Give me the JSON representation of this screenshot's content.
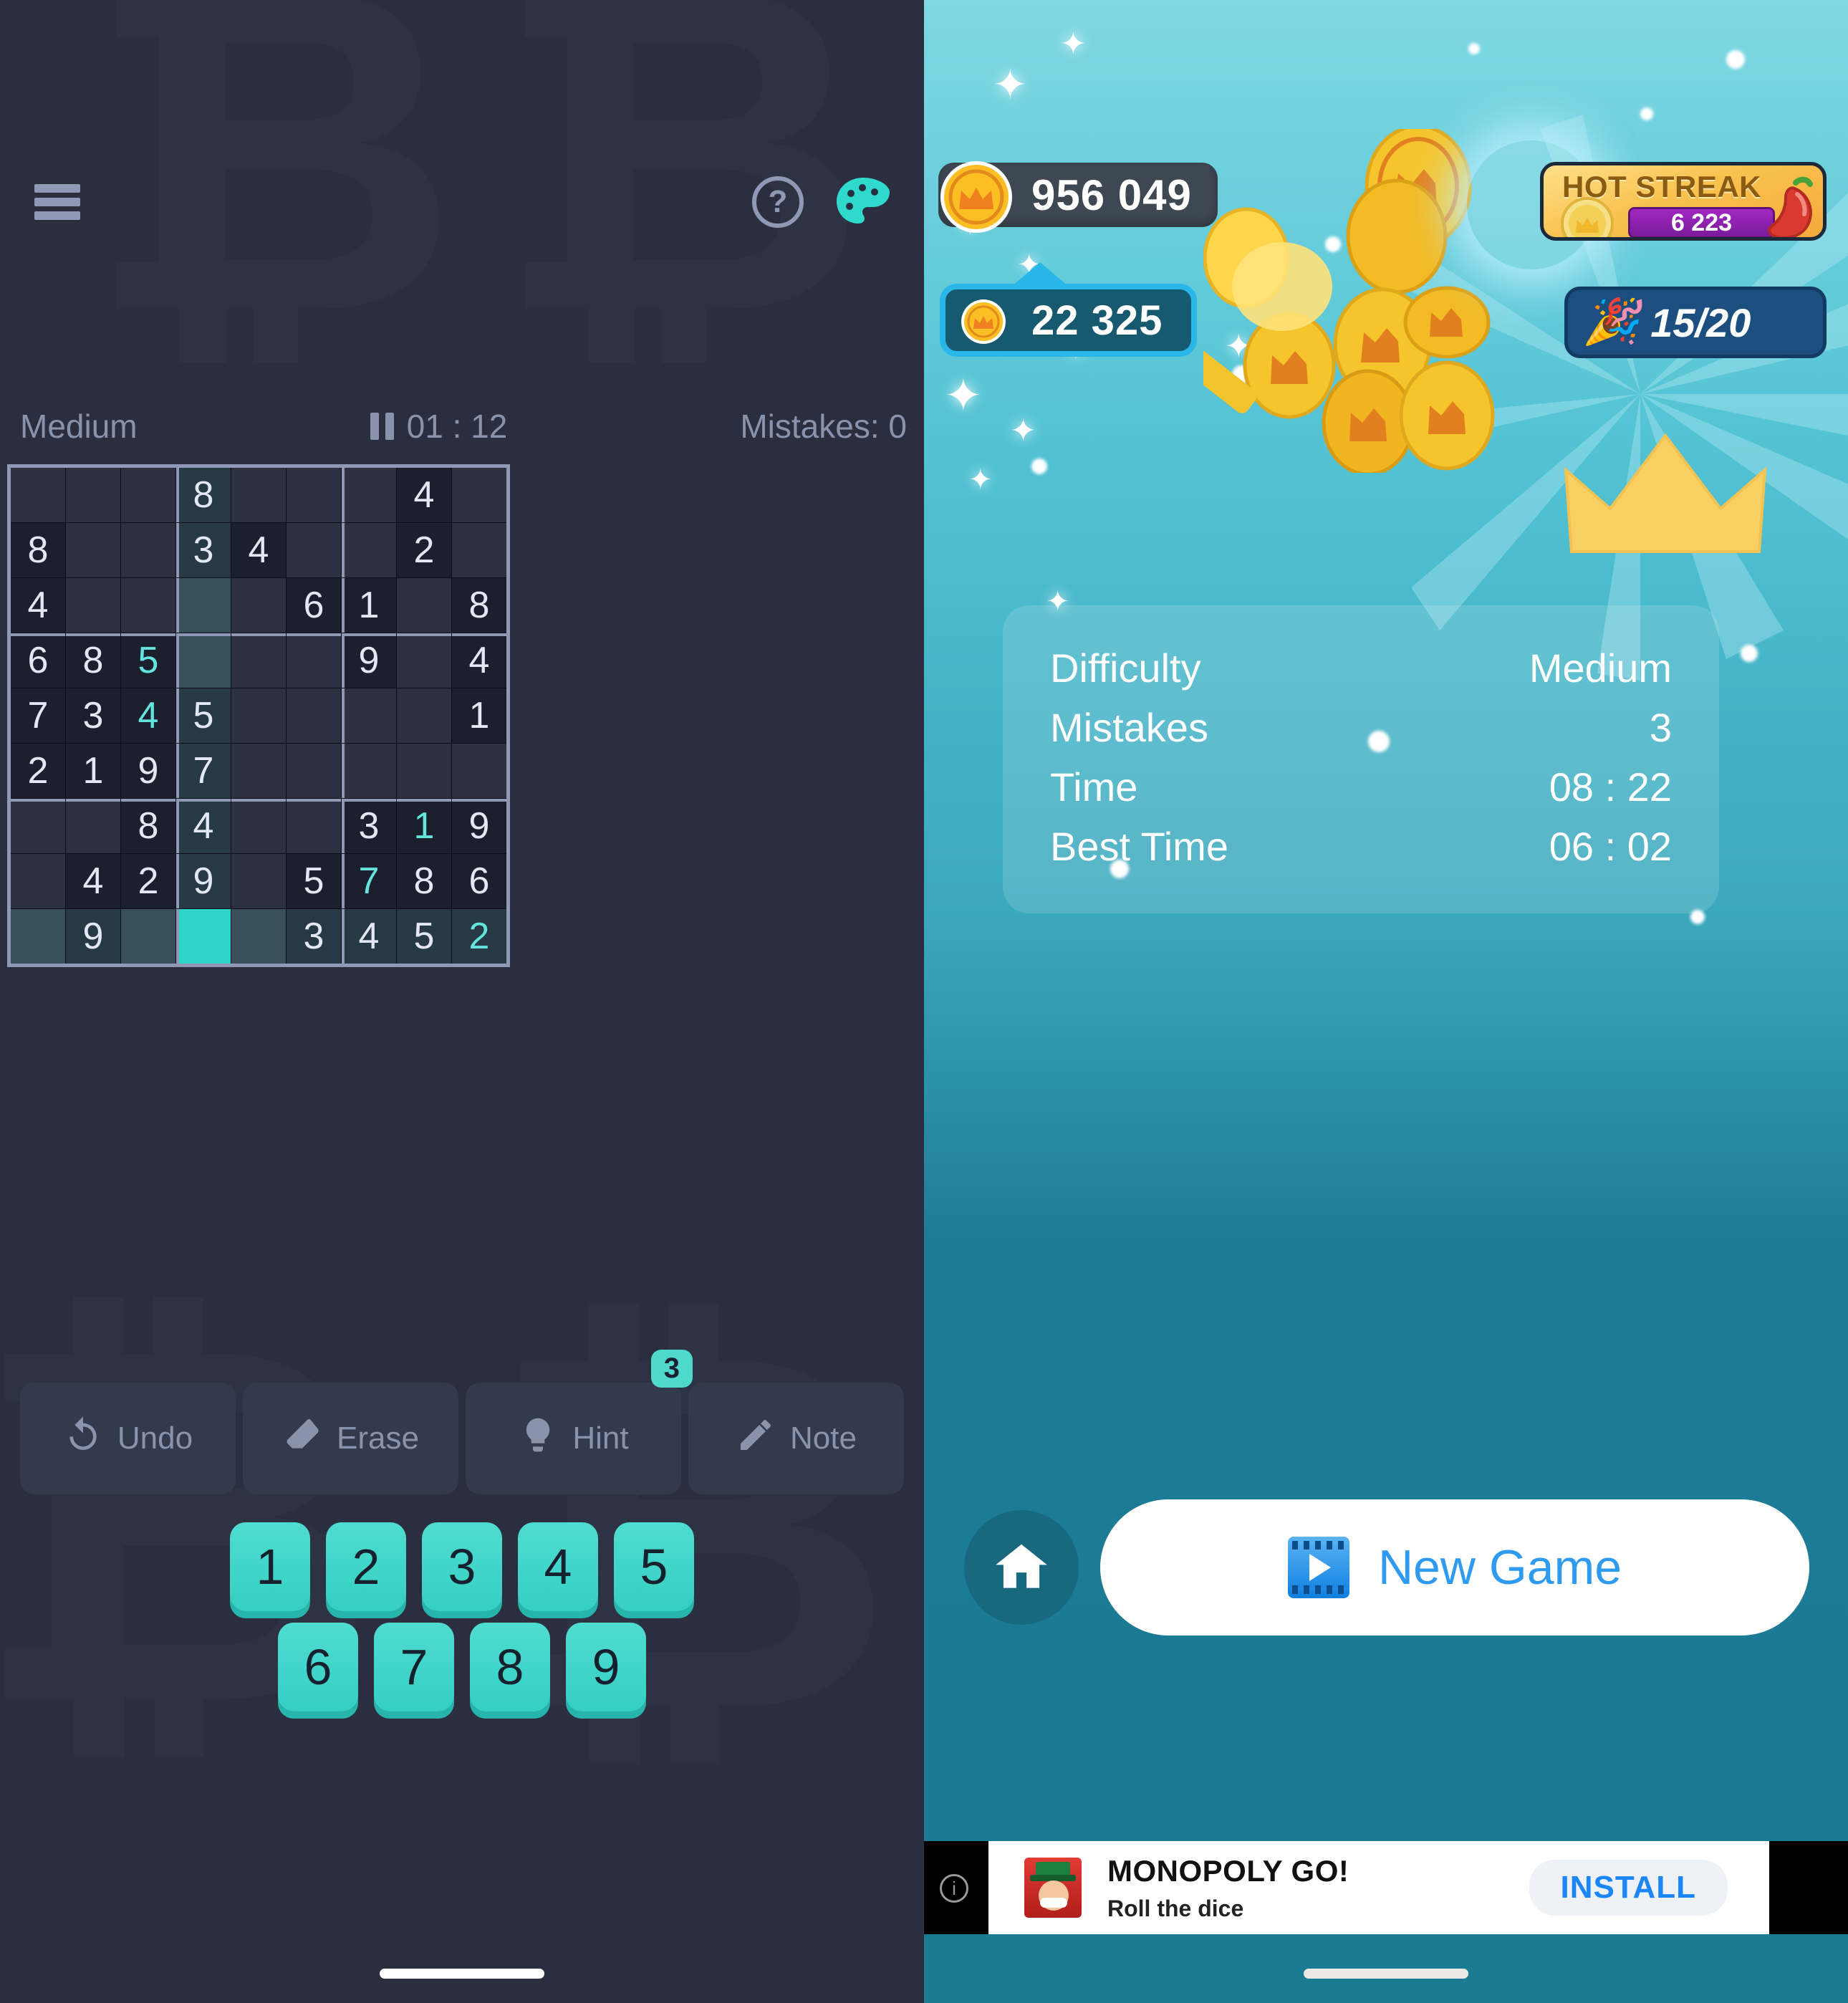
{
  "left_pane": {
    "header": {
      "menu_icon": "hamburger-menu-icon",
      "help_icon": "question-mark-icon",
      "help_glyph": "?",
      "theme_icon": "palette-icon"
    },
    "status": {
      "difficulty": "Medium",
      "pause_icon": "pause-icon",
      "timer": "01 : 12",
      "mistakes": "Mistakes: 0"
    },
    "board": {
      "selected_cell": {
        "row": 8,
        "col": 3
      },
      "highlight_row": 8,
      "highlight_col": 3,
      "rows": [
        [
          {
            "v": "",
            "t": "empty"
          },
          {
            "v": "",
            "t": "empty"
          },
          {
            "v": "",
            "t": "empty"
          },
          {
            "v": "8",
            "t": "given"
          },
          {
            "v": "",
            "t": "empty"
          },
          {
            "v": "",
            "t": "empty"
          },
          {
            "v": "",
            "t": "empty"
          },
          {
            "v": "4",
            "t": "given"
          },
          {
            "v": "",
            "t": "empty"
          }
        ],
        [
          {
            "v": "8",
            "t": "given"
          },
          {
            "v": "",
            "t": "empty"
          },
          {
            "v": "",
            "t": "empty"
          },
          {
            "v": "3",
            "t": "given"
          },
          {
            "v": "4",
            "t": "given"
          },
          {
            "v": "",
            "t": "empty"
          },
          {
            "v": "",
            "t": "empty"
          },
          {
            "v": "2",
            "t": "given"
          },
          {
            "v": "",
            "t": "empty"
          }
        ],
        [
          {
            "v": "4",
            "t": "given"
          },
          {
            "v": "",
            "t": "empty"
          },
          {
            "v": "",
            "t": "empty"
          },
          {
            "v": "",
            "t": "empty"
          },
          {
            "v": "",
            "t": "empty"
          },
          {
            "v": "6",
            "t": "given"
          },
          {
            "v": "1",
            "t": "given"
          },
          {
            "v": "",
            "t": "empty"
          },
          {
            "v": "8",
            "t": "given"
          }
        ],
        [
          {
            "v": "6",
            "t": "given"
          },
          {
            "v": "8",
            "t": "given"
          },
          {
            "v": "5",
            "t": "user"
          },
          {
            "v": "",
            "t": "empty"
          },
          {
            "v": "",
            "t": "empty"
          },
          {
            "v": "",
            "t": "empty"
          },
          {
            "v": "9",
            "t": "given"
          },
          {
            "v": "",
            "t": "empty"
          },
          {
            "v": "4",
            "t": "given"
          }
        ],
        [
          {
            "v": "7",
            "t": "given"
          },
          {
            "v": "3",
            "t": "given"
          },
          {
            "v": "4",
            "t": "user"
          },
          {
            "v": "5",
            "t": "given"
          },
          {
            "v": "",
            "t": "empty"
          },
          {
            "v": "",
            "t": "empty"
          },
          {
            "v": "",
            "t": "empty"
          },
          {
            "v": "",
            "t": "empty"
          },
          {
            "v": "1",
            "t": "given"
          }
        ],
        [
          {
            "v": "2",
            "t": "given"
          },
          {
            "v": "1",
            "t": "given"
          },
          {
            "v": "9",
            "t": "given"
          },
          {
            "v": "7",
            "t": "given"
          },
          {
            "v": "",
            "t": "empty"
          },
          {
            "v": "",
            "t": "empty"
          },
          {
            "v": "",
            "t": "empty"
          },
          {
            "v": "",
            "t": "empty"
          },
          {
            "v": "",
            "t": "empty"
          }
        ],
        [
          {
            "v": "",
            "t": "empty"
          },
          {
            "v": "",
            "t": "empty"
          },
          {
            "v": "8",
            "t": "given"
          },
          {
            "v": "4",
            "t": "given"
          },
          {
            "v": "",
            "t": "empty"
          },
          {
            "v": "",
            "t": "empty"
          },
          {
            "v": "3",
            "t": "given"
          },
          {
            "v": "1",
            "t": "user"
          },
          {
            "v": "9",
            "t": "given"
          }
        ],
        [
          {
            "v": "",
            "t": "empty"
          },
          {
            "v": "4",
            "t": "given"
          },
          {
            "v": "2",
            "t": "given"
          },
          {
            "v": "9",
            "t": "given"
          },
          {
            "v": "",
            "t": "empty"
          },
          {
            "v": "5",
            "t": "given"
          },
          {
            "v": "7",
            "t": "user"
          },
          {
            "v": "8",
            "t": "given"
          },
          {
            "v": "6",
            "t": "given"
          }
        ],
        [
          {
            "v": "",
            "t": "empty"
          },
          {
            "v": "9",
            "t": "given"
          },
          {
            "v": "",
            "t": "empty"
          },
          {
            "v": "",
            "t": "selected"
          },
          {
            "v": "",
            "t": "empty"
          },
          {
            "v": "3",
            "t": "given"
          },
          {
            "v": "4",
            "t": "given"
          },
          {
            "v": "5",
            "t": "given"
          },
          {
            "v": "2",
            "t": "user"
          }
        ]
      ]
    },
    "toolbar": [
      {
        "label": "Undo",
        "icon": "undo-icon",
        "badge": ""
      },
      {
        "label": "Erase",
        "icon": "eraser-icon",
        "badge": ""
      },
      {
        "label": "Hint",
        "icon": "lightbulb-icon",
        "badge": "3"
      },
      {
        "label": "Note",
        "icon": "pencil-icon",
        "badge": ""
      }
    ],
    "numpad": {
      "row1": [
        "1",
        "2",
        "3",
        "4",
        "5"
      ],
      "row2": [
        "6",
        "7",
        "8",
        "9"
      ]
    }
  },
  "right_pane": {
    "coin_total": "956 049",
    "coin_earned": "22 325",
    "hot_streak": {
      "title": "HOT STREAK",
      "value": "6 223",
      "chili_icon": "chili-pepper-icon",
      "coin_icon": "coin-icon"
    },
    "progress": {
      "value": "15/20",
      "icon": "party-popper-icon"
    },
    "stats": [
      {
        "label": "Difficulty",
        "value": "Medium"
      },
      {
        "label": "Mistakes",
        "value": "3"
      },
      {
        "label": "Time",
        "value": "08 : 22"
      },
      {
        "label": "Best Time",
        "value": "06 : 02"
      }
    ],
    "actions": {
      "home_icon": "home-icon",
      "new_game_label": "New Game",
      "new_game_icon": "video-ad-icon"
    },
    "ad": {
      "info_glyph": "i",
      "title": "MONOPOLY GO!",
      "subtitle": "Roll the dice",
      "cta": "INSTALL",
      "icon": "monopoly-app-icon"
    }
  },
  "colors": {
    "accent_teal": "#4fd9cd",
    "board_bg": "#2d3142",
    "filled_cell": "#1b1f2e",
    "highlight_cell": "#38505c",
    "selected_cell": "#2fd4c8",
    "left_bg": "#2a2e3f",
    "right_top": "#7fd8e3",
    "right_bottom": "#1b7b93",
    "new_game_text": "#2f9bf0",
    "install_text": "#1b86f7"
  }
}
